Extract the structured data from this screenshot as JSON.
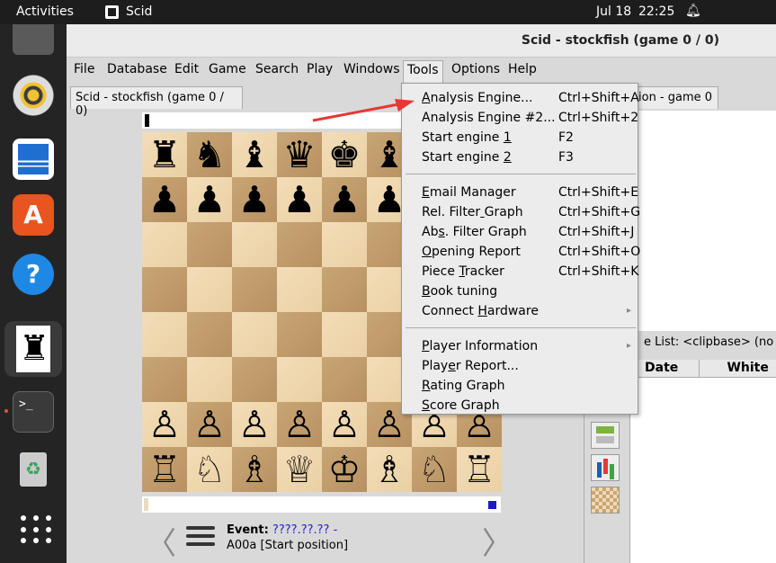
{
  "topbar": {
    "activities": "Activities",
    "app_name": "Scid",
    "date": "Jul 18",
    "time": "22:25"
  },
  "window": {
    "title": "Scid - stockfish (game 0 / 0)",
    "menus": [
      "File",
      "Database",
      "Edit",
      "Game",
      "Search",
      "Play",
      "Windows",
      "Tools",
      "Options",
      "Help"
    ],
    "tab_main": "Scid - stockfish (game 0 / 0)",
    "tab_right": "ion - game 0",
    "list_title": "e List: <clipbase> (no ga",
    "table_headers": [
      "Date",
      "White"
    ]
  },
  "game": {
    "event_label": "Event:",
    "event_date": "????.??.?? -",
    "opening": "A00a [Start position]"
  },
  "board": [
    [
      "♜",
      "♞",
      "♝",
      "♛",
      "♚",
      "♝",
      "♞",
      "♜"
    ],
    [
      "♟",
      "♟",
      "♟",
      "♟",
      "♟",
      "♟",
      "♟",
      "♟"
    ],
    [
      "",
      "",
      "",
      "",
      "",
      "",
      "",
      ""
    ],
    [
      "",
      "",
      "",
      "",
      "",
      "",
      "",
      ""
    ],
    [
      "",
      "",
      "",
      "",
      "",
      "",
      "",
      ""
    ],
    [
      "",
      "",
      "",
      "",
      "",
      "",
      "",
      ""
    ],
    [
      "♙",
      "♙",
      "♙",
      "♙",
      "♙",
      "♙",
      "♙",
      "♙"
    ],
    [
      "♖",
      "♘",
      "♗",
      "♕",
      "♔",
      "♗",
      "♘",
      "♖"
    ]
  ],
  "tools_menu": {
    "groups": [
      [
        {
          "label": "Analysis Engine...",
          "u": 0,
          "acc": "Ctrl+Shift+A"
        },
        {
          "label": "Analysis Engine #2...",
          "u": -1,
          "acc": "Ctrl+Shift+2"
        },
        {
          "label": "Start engine 1",
          "u": 13,
          "acc": "F2"
        },
        {
          "label": "Start engine 2",
          "u": 13,
          "acc": "F3"
        }
      ],
      [
        {
          "label": "Email Manager",
          "u": 0,
          "acc": "Ctrl+Shift+E"
        },
        {
          "label": "Rel. Filter Graph",
          "u": 11,
          "acc": "Ctrl+Shift+G"
        },
        {
          "label": "Abs. Filter Graph",
          "u": 2,
          "acc": "Ctrl+Shift+J"
        },
        {
          "label": "Opening Report",
          "u": 0,
          "acc": "Ctrl+Shift+O"
        },
        {
          "label": "Piece Tracker",
          "u": 6,
          "acc": "Ctrl+Shift+K"
        },
        {
          "label": "Book tuning",
          "u": 0,
          "acc": ""
        },
        {
          "label": "Connect Hardware",
          "u": 8,
          "acc": "",
          "sub": true
        }
      ],
      [
        {
          "label": "Player Information",
          "u": 0,
          "acc": "",
          "sub": true
        },
        {
          "label": "Player Report...",
          "u": 4,
          "acc": ""
        },
        {
          "label": "Rating Graph",
          "u": 0,
          "acc": ""
        },
        {
          "label": "Score Graph",
          "u": 0,
          "acc": ""
        }
      ]
    ]
  }
}
